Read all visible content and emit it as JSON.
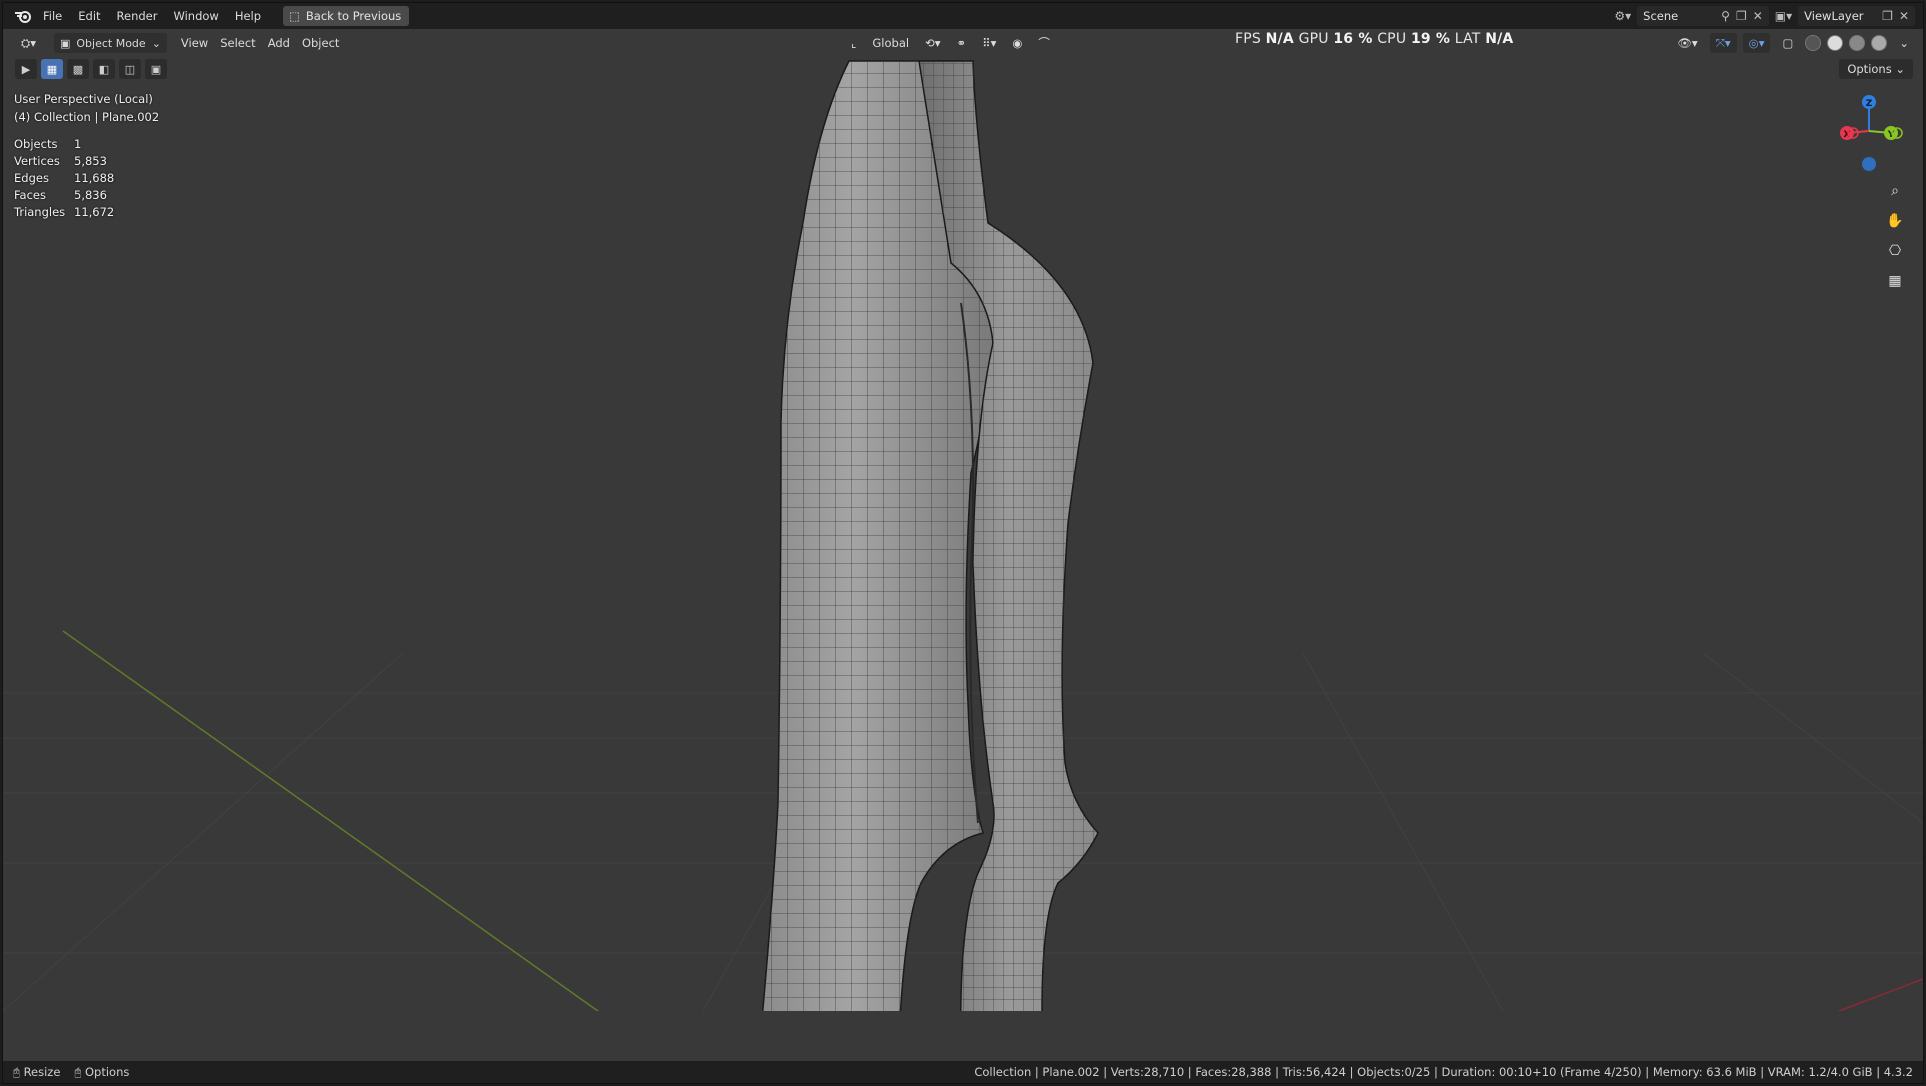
{
  "menubar": {
    "items": [
      "File",
      "Edit",
      "Render",
      "Window",
      "Help"
    ],
    "back_button": "Back to Previous",
    "scene_label": "Scene",
    "viewlayer_label": "ViewLayer"
  },
  "header": {
    "mode": "Object Mode",
    "menus": [
      "View",
      "Select",
      "Add",
      "Object"
    ],
    "orientation": "Global",
    "perf": {
      "fps_label": "FPS",
      "fps": "N/A",
      "gpu_label": "GPU",
      "gpu": "16 %",
      "cpu_label": "CPU",
      "cpu": "19 %",
      "lat_label": "LAT",
      "lat": "N/A"
    }
  },
  "viewport": {
    "options_label": "Options",
    "view_name": "User Perspective (Local)",
    "collection": "(4) Collection | Plane.002",
    "stats": [
      {
        "key": "Objects",
        "value": "1"
      },
      {
        "key": "Vertices",
        "value": "5,853"
      },
      {
        "key": "Edges",
        "value": "11,688"
      },
      {
        "key": "Faces",
        "value": "5,836"
      },
      {
        "key": "Triangles",
        "value": "11,672"
      }
    ],
    "gizmo": {
      "z": "Z",
      "y": "Y",
      "x": "X"
    }
  },
  "status": {
    "resize": "Resize",
    "options": "Options",
    "info": "Collection | Plane.002 | Verts:28,710 | Faces:28,388 | Tris:56,424 | Objects:0/25 | Duration: 00:10+10 (Frame 4/250) | Memory: 63.6 MiB | VRAM: 1.2/4.0 GiB | 4.3.2"
  },
  "colors": {
    "accent": "#4772b3",
    "axis_x": "#e8374f",
    "axis_y": "#8bc425",
    "axis_z": "#2e7fe0"
  }
}
